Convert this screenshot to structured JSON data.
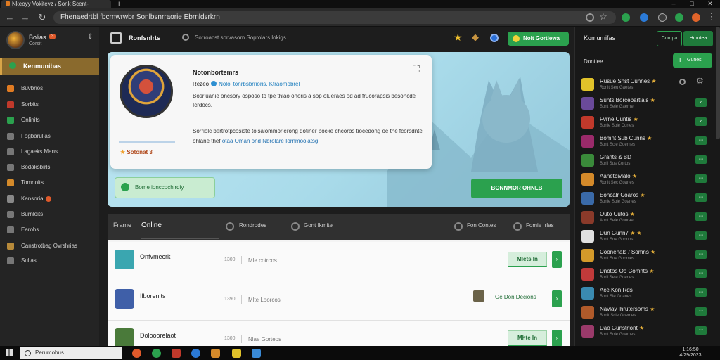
{
  "browser": {
    "tab_title": "Nkeoyy Vokitevz / Sonk Scent-",
    "new_tab_symbol": "+",
    "address": "Fhenaedrtbl fbcrnwrwbr Sonlbsnrraorie Ebrnldsrkrn",
    "window_controls": [
      "–",
      "□",
      "✕"
    ]
  },
  "sidebar": {
    "user_name": "Bolias",
    "user_badge": "3",
    "user_status": "Corsit",
    "active_item": "Kenmunibas",
    "items": [
      {
        "label": "Buvbrios",
        "icon": "coin-icon",
        "color": "#e07b22"
      },
      {
        "label": "Sorbits",
        "icon": "controller-icon",
        "color": "#c0392b"
      },
      {
        "label": "Gnlinits",
        "icon": "cart-icon",
        "color": "#2ba14e"
      },
      {
        "label": "Fogbarulias",
        "icon": "doc-icon",
        "color": "#777777"
      },
      {
        "label": "Lagaeks Mans",
        "icon": "grid-icon",
        "color": "#777777"
      },
      {
        "label": "Bodaksbirls",
        "icon": "gear-icon",
        "color": "#777777"
      },
      {
        "label": "Tomnolts",
        "icon": "wallet-icon",
        "color": "#d48a2a"
      },
      {
        "label": "Kansoria",
        "icon": "mic-icon",
        "color": "#888888"
      },
      {
        "label": "Burnloits",
        "icon": "chart-icon",
        "color": "#777777"
      },
      {
        "label": "Earohs",
        "icon": "search-icon",
        "color": "#777777"
      },
      {
        "label": "Canstrotbag Ovrshrias",
        "icon": "box-icon",
        "color": "#b78a3a"
      },
      {
        "label": "Sulias",
        "icon": "list-icon",
        "color": "#777777"
      }
    ]
  },
  "main": {
    "topbar_title": "Ronfsnlrts",
    "search_placeholder": "Sorroacst sorvasom Soptolars lokigs",
    "cta_label": "Noit Gortiewa",
    "profile": {
      "rank": "Sotonat 3",
      "name": "Notonbortemrs",
      "tagline_lead": "Rezeo",
      "tagline_link": "Nolol tonrbsbrrioris. Ktraomobrel",
      "bio": "Bosriuanie oncsory osposo to tpe thlao onoris a sop olueraes od ad frucorapsis besoncde Icrdocs.",
      "about": "Sorriolc bertrotpcosiste tolsalommorlerong dotiner bocke chcorbs tiocedong oe the fcorsdnte ohlane thef",
      "about_link": "otaa Oman ond Nbrolare",
      "about_end": "Iornmoolatsg."
    },
    "status_box": "Bome ionccochirdiy",
    "hero_cta": "BONNMOR OHNLB",
    "friends": {
      "tab_all": "Frame",
      "tab_online": "Online",
      "tab_a": "Rondrodes",
      "tab_b": "Gont Ikmite",
      "tab_c": "Fon Contes",
      "tab_d": "Fomie Irlas",
      "rows": [
        {
          "name": "Onfvmecrk",
          "num": "1300",
          "status": "Mle cotrcos",
          "action": "Mlets In",
          "more": "›",
          "avatar_color": "#3aa6b0"
        },
        {
          "name": "Ilborenits",
          "num": "1390",
          "status": "Mlte Loorcos",
          "game": "Oe Don Decions",
          "more": "›",
          "avatar_color": "#3f5fa8"
        },
        {
          "name": "Dolooorelaot",
          "num": "1300",
          "status": "Nlae Gorteos",
          "action": "Mhte In",
          "more": "›",
          "avatar_color": "#4a7a3a"
        }
      ]
    }
  },
  "right_panel": {
    "title": "Komumifas",
    "btn_outline": "Compa",
    "btn_filled": "Hmntea",
    "subtitle": "Dontiee",
    "add_label": "Gunes",
    "items": [
      {
        "name": "Rusue Snst Cunnes",
        "star": "★",
        "status": "Ronit Seu Gaetes",
        "action": "",
        "color": "#e0c22a"
      },
      {
        "name": "Sunts Borcebartlais",
        "star": "★",
        "status": "Bont Seie Gaerne",
        "action": "✓",
        "color": "#6a4a9a"
      },
      {
        "name": "Fvrne Cuntis",
        "star": "★",
        "status": "Bonle Soie Cortes",
        "action": "✓",
        "color": "#c0392b"
      },
      {
        "name": "Bomnt Sub Cunns",
        "star": "★",
        "status": "Bont Scie Goemes",
        "action": "···",
        "color": "#9a2a6a"
      },
      {
        "name": "Grants & BD",
        "star": "",
        "status": "Boril Sus Cortos",
        "action": "···",
        "color": "#3a8a3a"
      },
      {
        "name": "Aanetbivlalo",
        "star": "★",
        "status": "Ronit Sec Goanes",
        "action": "···",
        "color": "#d48a2a"
      },
      {
        "name": "Eoncalr Coaros",
        "star": "★",
        "status": "Bonle Soie Goanes",
        "action": "···",
        "color": "#3a6aa8"
      },
      {
        "name": "Outo Cutos",
        "star": "★",
        "status": "Aont Seie Goorae",
        "action": "···",
        "color": "#8a3a2a"
      },
      {
        "name": "Dun Gunn7",
        "star": "★ ★",
        "status": "Bont Sne Goonos",
        "action": "···",
        "color": "#e0e0e0"
      },
      {
        "name": "Coonenals / Somns",
        "star": "★",
        "status": "Bont Sue Goomes",
        "action": "···",
        "color": "#d49a2a"
      },
      {
        "name": "Dnotos Oo Comnts",
        "star": "★",
        "status": "Boril Seie Goenes",
        "action": "···",
        "color": "#c03a3a"
      },
      {
        "name": "Ace Kon Rds",
        "star": "",
        "status": "Bont Sie Goanes",
        "action": "···",
        "color": "#3a8ab0"
      },
      {
        "name": "Navlay Ihrutersoms",
        "star": "★",
        "status": "Bonit Scie Goemes",
        "action": "···",
        "color": "#b05a2a"
      },
      {
        "name": "Dao Gunstrlont",
        "star": "★",
        "status": "Bont Soie Goames",
        "action": "···",
        "color": "#9a3a6a"
      }
    ]
  },
  "taskbar": {
    "search_text": "Perumobus",
    "clock_time": "1:16:50",
    "clock_date": "4/29/2023"
  }
}
